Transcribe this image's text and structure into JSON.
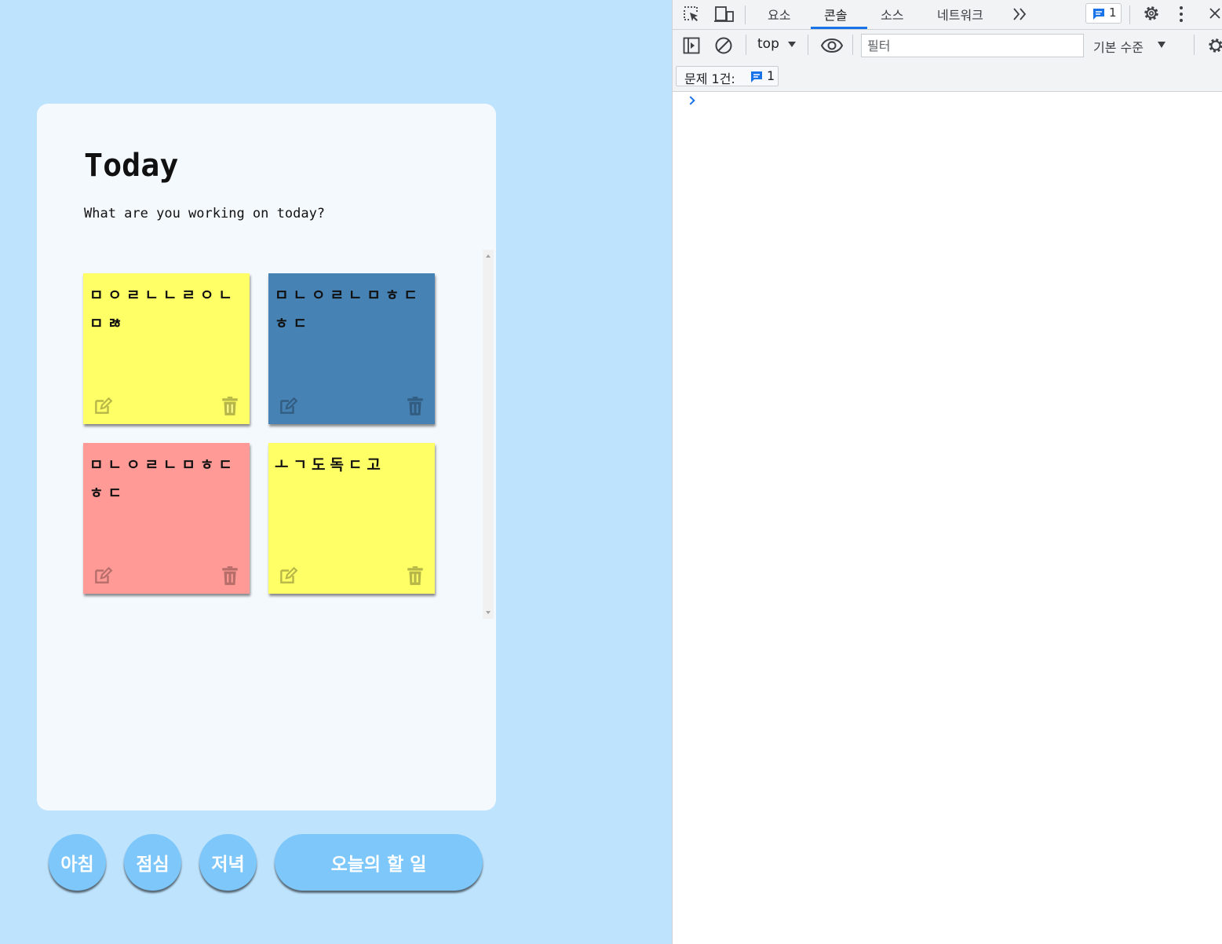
{
  "app": {
    "title": "Today",
    "subtitle": "What are you working on today?",
    "notes": [
      {
        "text": "ㅁㅇㄹㄴㄴㄹㅇㄴㅁㅀ",
        "color": "#ffff66"
      },
      {
        "text": "ㅁㄴㅇㄹㄴㅁㅎㄷㅎㄷ",
        "color": "#4682b4"
      },
      {
        "text": "ㅁㄴㅇㄹㄴㅁㅎㄷㅎㄷ",
        "color": "#ff9a96"
      },
      {
        "text": "ㅗㄱ도독ㄷ고",
        "color": "#ffff66"
      }
    ],
    "note_icons": {
      "edit": "edit-icon",
      "delete": "trash-icon"
    },
    "nav": {
      "morning": "아침",
      "lunch": "점심",
      "dinner": "저녁",
      "todo": "오늘의 할 일"
    },
    "colors": {
      "background": "#bee3fd",
      "card": "#f4f9fe",
      "button": "#7ec7fb"
    }
  },
  "devtools": {
    "tabs": [
      "요소",
      "콘솔",
      "소스",
      "네트워크"
    ],
    "active_tab": "콘솔",
    "issues_badge_count": "1",
    "context": "top",
    "filter_placeholder": "필터",
    "level": "기본 수준",
    "issues_label": "문제 1건:",
    "issues_count": "1",
    "accent": "#1a73e8"
  }
}
